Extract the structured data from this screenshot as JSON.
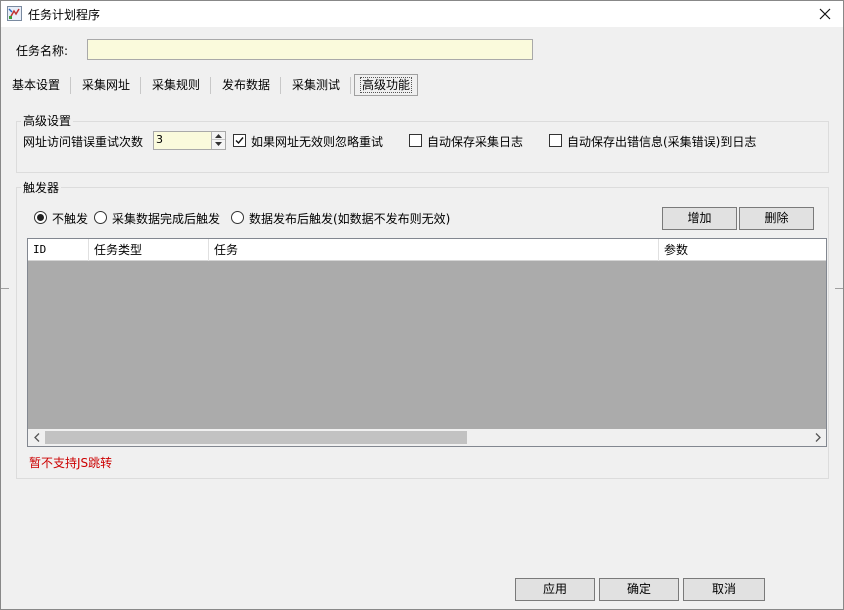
{
  "window": {
    "title": "任务计划程序",
    "icon": "task-scheduler-icon",
    "close_icon": "close-icon"
  },
  "task_name": {
    "label": "任务名称:",
    "value": ""
  },
  "tabs": [
    {
      "label": "基本设置",
      "active": false
    },
    {
      "label": "采集网址",
      "active": false
    },
    {
      "label": "采集规则",
      "active": false
    },
    {
      "label": "发布数据",
      "active": false
    },
    {
      "label": "采集测试",
      "active": false
    },
    {
      "label": "高级功能",
      "active": true
    }
  ],
  "advanced": {
    "group_title": "高级设置",
    "retry_label": "网址访问错误重试次数",
    "retry_value": "3",
    "ignore_retry": {
      "label": "如果网址无效则忽略重试",
      "checked": true
    },
    "auto_save_log": {
      "label": "自动保存采集日志",
      "checked": false
    },
    "auto_save_error": {
      "label": "自动保存出错信息(采集错误)到日志",
      "checked": false
    }
  },
  "trigger": {
    "group_title": "触发器",
    "options": [
      {
        "label": "不触发",
        "selected": true
      },
      {
        "label": "采集数据完成后触发",
        "selected": false
      },
      {
        "label": "数据发布后触发(如数据不发布则无效)",
        "selected": false
      }
    ],
    "add_label": "增加",
    "delete_label": "删除",
    "columns": [
      "ID",
      "任务类型",
      "任务",
      "参数"
    ],
    "rows": [],
    "warning": "暂不支持JS跳转"
  },
  "footer": {
    "apply_label": "应用",
    "ok_label": "确定",
    "cancel_label": "取消"
  },
  "colors": {
    "input_bg": "#fafadc",
    "grid_bg": "#ababab",
    "warning": "#cc0000"
  }
}
